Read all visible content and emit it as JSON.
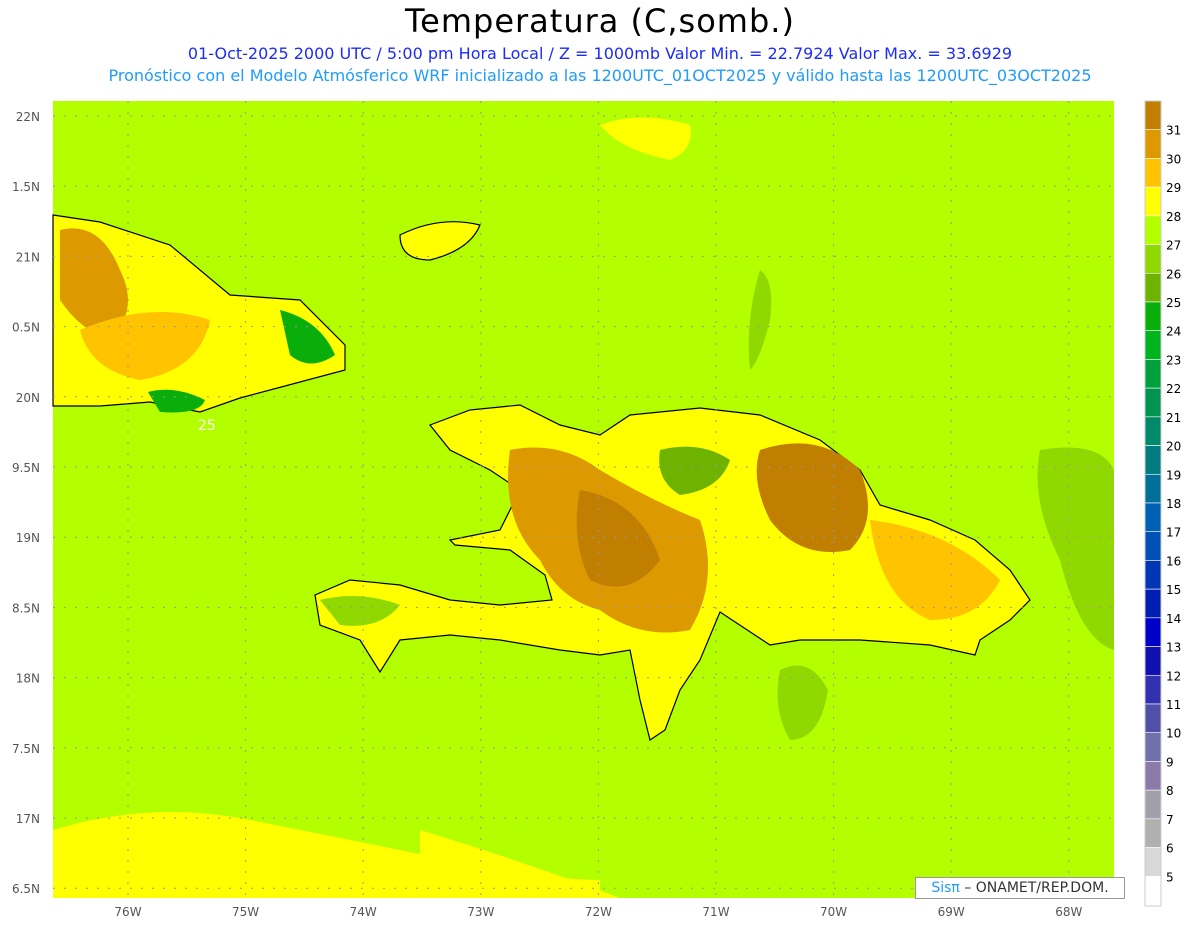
{
  "title": "Temperatura (C,somb.)",
  "subtitle1": "01-Oct-2025  2000 UTC / 5:00 pm Hora Local / Z = 1000mb    Valor Min. = 22.7924  Valor Max. = 33.6929",
  "subtitle2": "Pronóstico con el Modelo Atmósferico WRF inicializado a las 1200UTC_01OCT2025 y válido hasta las  1200UTC_03OCT2025",
  "lat_labels": [
    "22N",
    "1.5N",
    "21N",
    "0.5N",
    "20N",
    "9.5N",
    "19N",
    "8.5N",
    "18N",
    "7.5N",
    "17N",
    "6.5N"
  ],
  "lon_labels": [
    "76W",
    "75W",
    "74W",
    "73W",
    "72W",
    "71W",
    "70W",
    "69W",
    "68W"
  ],
  "contour_label": "25",
  "colorbar": {
    "labels": [
      "31",
      "30",
      "29",
      "28",
      "27",
      "26",
      "25",
      "24",
      "23",
      "22",
      "21",
      "20",
      "19",
      "18",
      "17",
      "16",
      "15",
      "14",
      "13",
      "12",
      "11",
      "10",
      "9",
      "8",
      "7",
      "6",
      "5"
    ],
    "colors": [
      "#c07f00",
      "#dc9a00",
      "#ffc300",
      "#ffff00",
      "#b3ff00",
      "#8fd800",
      "#6db300",
      "#0aae0a",
      "#00b41e",
      "#00a03c",
      "#009450",
      "#008a6a",
      "#007c80",
      "#00709a",
      "#0060b4",
      "#0050b8",
      "#0036b4",
      "#001eb0",
      "#0000c8",
      "#1010b0",
      "#3232b0",
      "#5050a8",
      "#7070aa",
      "#8c7aaa",
      "#a0a0aa",
      "#b0b0b0",
      "#d8d8d8",
      "#ffffff"
    ]
  },
  "credit": {
    "logo": "Sisπ",
    "text": "– ONAMET/REP.DOM."
  }
}
